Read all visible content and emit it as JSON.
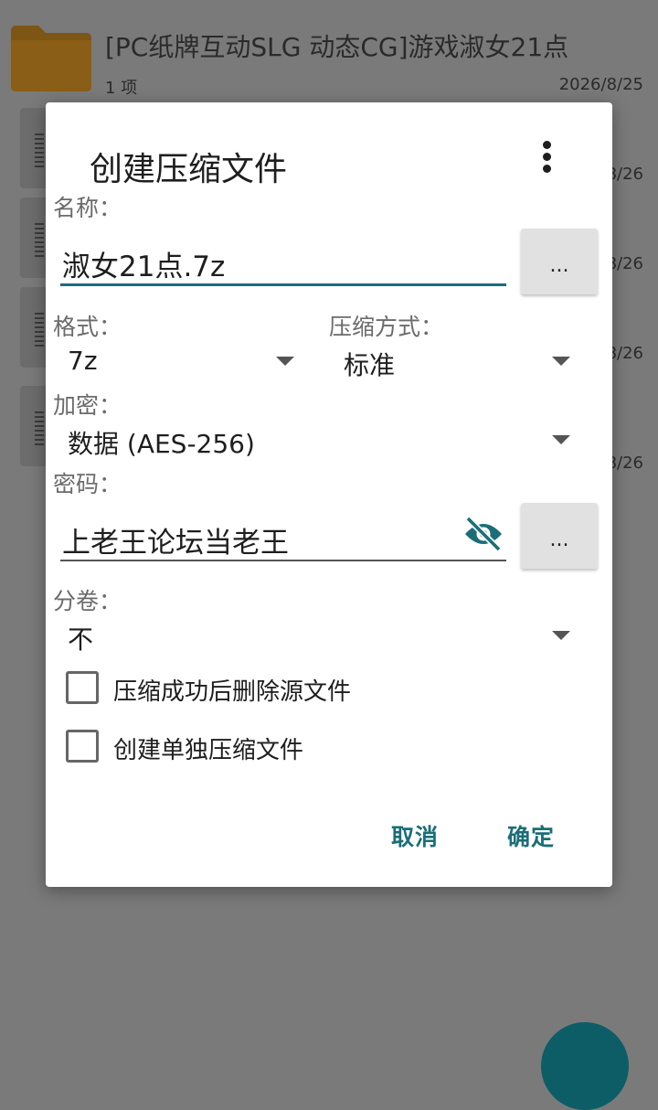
{
  "background": {
    "folder": {
      "title": "[PC纸牌互动SLG 动态CG]游戏淑女21点",
      "subtitle": "1 项",
      "date": "2026/8/25"
    },
    "files": [
      {
        "date": "8/26"
      },
      {
        "date": "8/26"
      },
      {
        "date": "8/26"
      },
      {
        "date": "8/26"
      }
    ]
  },
  "dialog": {
    "title": "创建压缩文件",
    "name_label": "名称：",
    "name_value": "淑女21点.7z",
    "browse_label": "...",
    "format_label": "格式：",
    "format_value": "7z",
    "method_label": "压缩方式：",
    "method_value": "标准",
    "encrypt_label": "加密：",
    "encrypt_value": "数据 (AES-256)",
    "password_label": "密码：",
    "password_value": "上老王论坛当老王",
    "password_browse_label": "...",
    "split_label": "分卷：",
    "split_value": "不",
    "delete_source_label": "压缩成功后删除源文件",
    "separate_archive_label": "创建单独压缩文件",
    "cancel_label": "取消",
    "ok_label": "确定"
  },
  "colors": {
    "accent": "#1a6e78",
    "folder": "#d4901e",
    "scrim": "#7a7a7a"
  }
}
